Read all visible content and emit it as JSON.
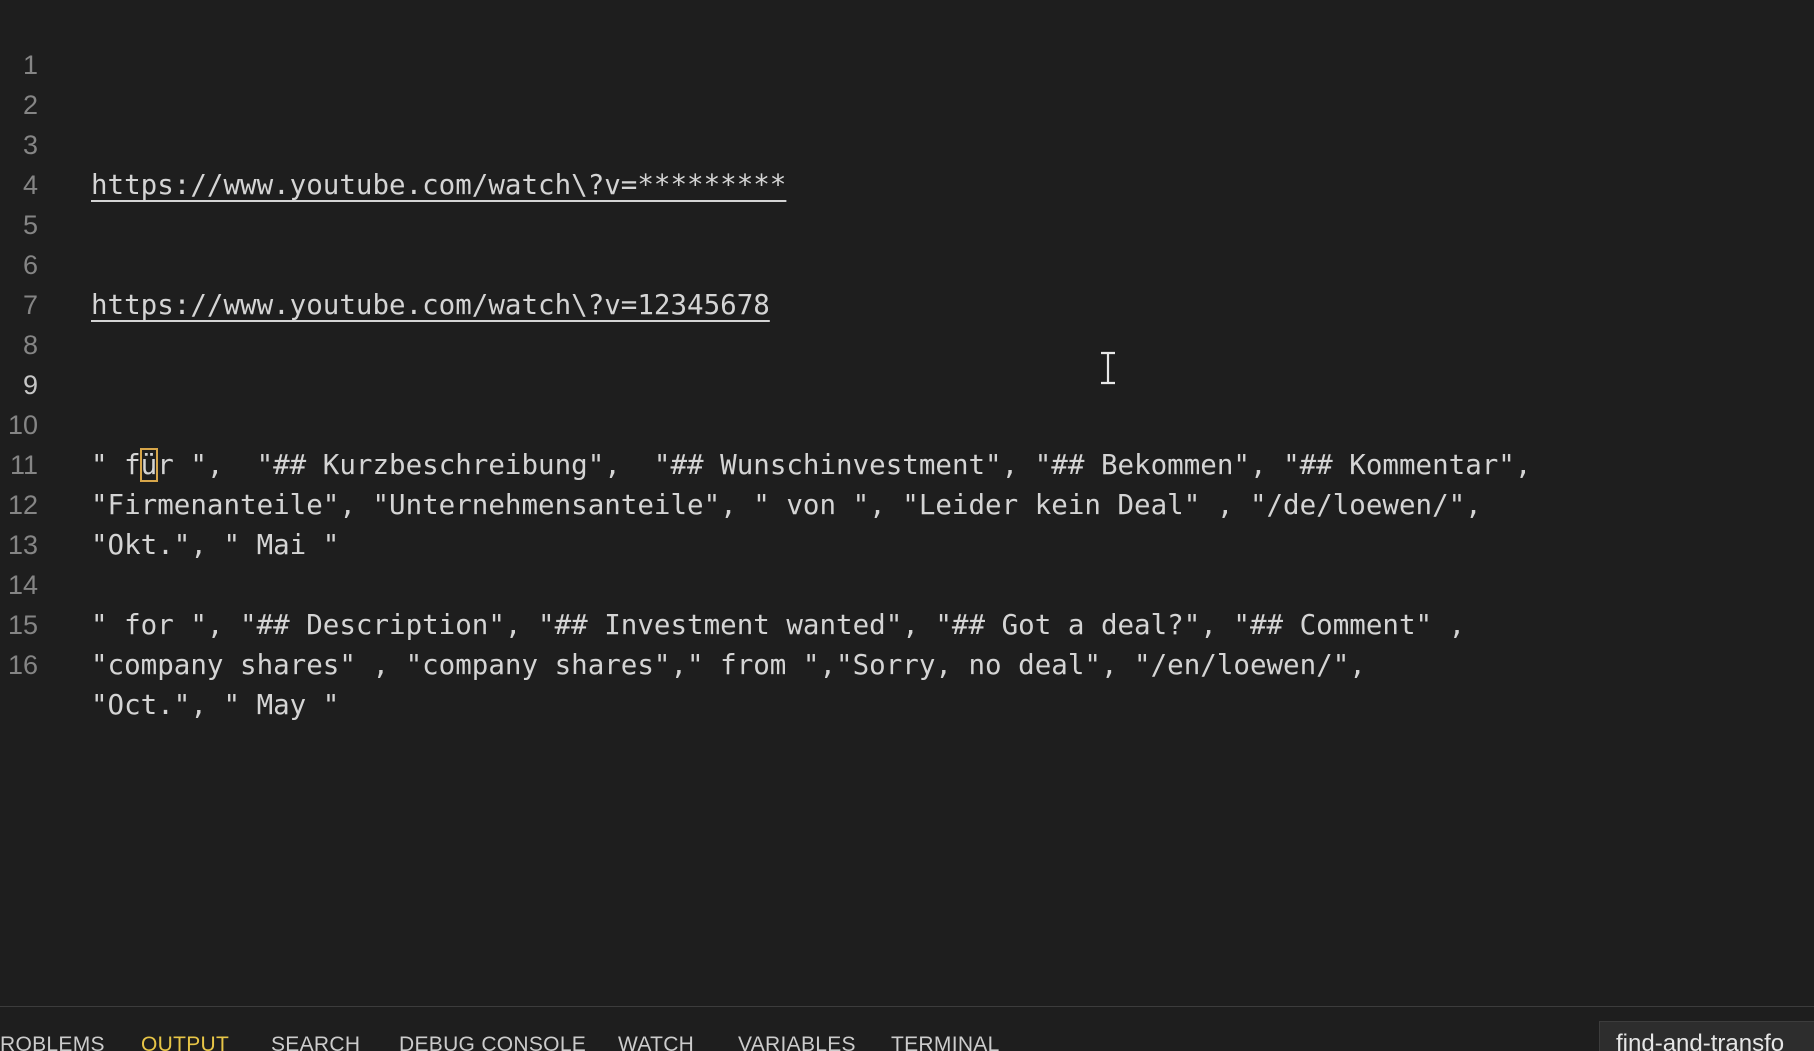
{
  "editor": {
    "lines": [
      {
        "num": "1",
        "text": ""
      },
      {
        "num": "2",
        "text": ""
      },
      {
        "num": "3",
        "text": "https://www.youtube.com/watch\\?v=*********"
      },
      {
        "num": "4",
        "text": ""
      },
      {
        "num": "5",
        "text": ""
      },
      {
        "num": "6",
        "text": "https://www.youtube.com/watch\\?v=12345678"
      },
      {
        "num": "7",
        "text": ""
      },
      {
        "num": "8",
        "text": ""
      },
      {
        "num": "9",
        "text": ""
      },
      {
        "num": "10",
        "pre": "\" f",
        "cursor": "ü",
        "post": "r \",  \"## Kurzbeschreibung\",  \"## Wunschinvestment\", \"## Bekommen\", \"## Kommentar\","
      },
      {
        "num": "11",
        "text": "\"Firmenanteile\", \"Unternehmensanteile\", \" von \", \"Leider kein Deal\" , \"/de/loewen/\","
      },
      {
        "num": "12",
        "text": "\"Okt.\", \" Mai \""
      },
      {
        "num": "13",
        "text": ""
      },
      {
        "num": "14",
        "text": "\" for \", \"## Description\", \"## Investment wanted\", \"## Got a deal?\", \"## Comment\" ,"
      },
      {
        "num": "15",
        "text": "\"company shares\" , \"company shares\",\" from \",\"Sorry, no deal\", \"/en/loewen/\","
      },
      {
        "num": "16",
        "text": "\"Oct.\", \" May \""
      }
    ],
    "current_line": "9"
  },
  "panel": {
    "tabs": [
      "ROBLEMS",
      "OUTPUT",
      "SEARCH",
      "DEBUG CONSOLE",
      "WATCH",
      "VARIABLES",
      "TERMINAL"
    ],
    "active_tab": "OUTPUT",
    "filter_value": "find-and-transfo",
    "active_color": "#e7c547"
  },
  "icons": {
    "mouse_cursor": "text-ibeam-icon"
  }
}
